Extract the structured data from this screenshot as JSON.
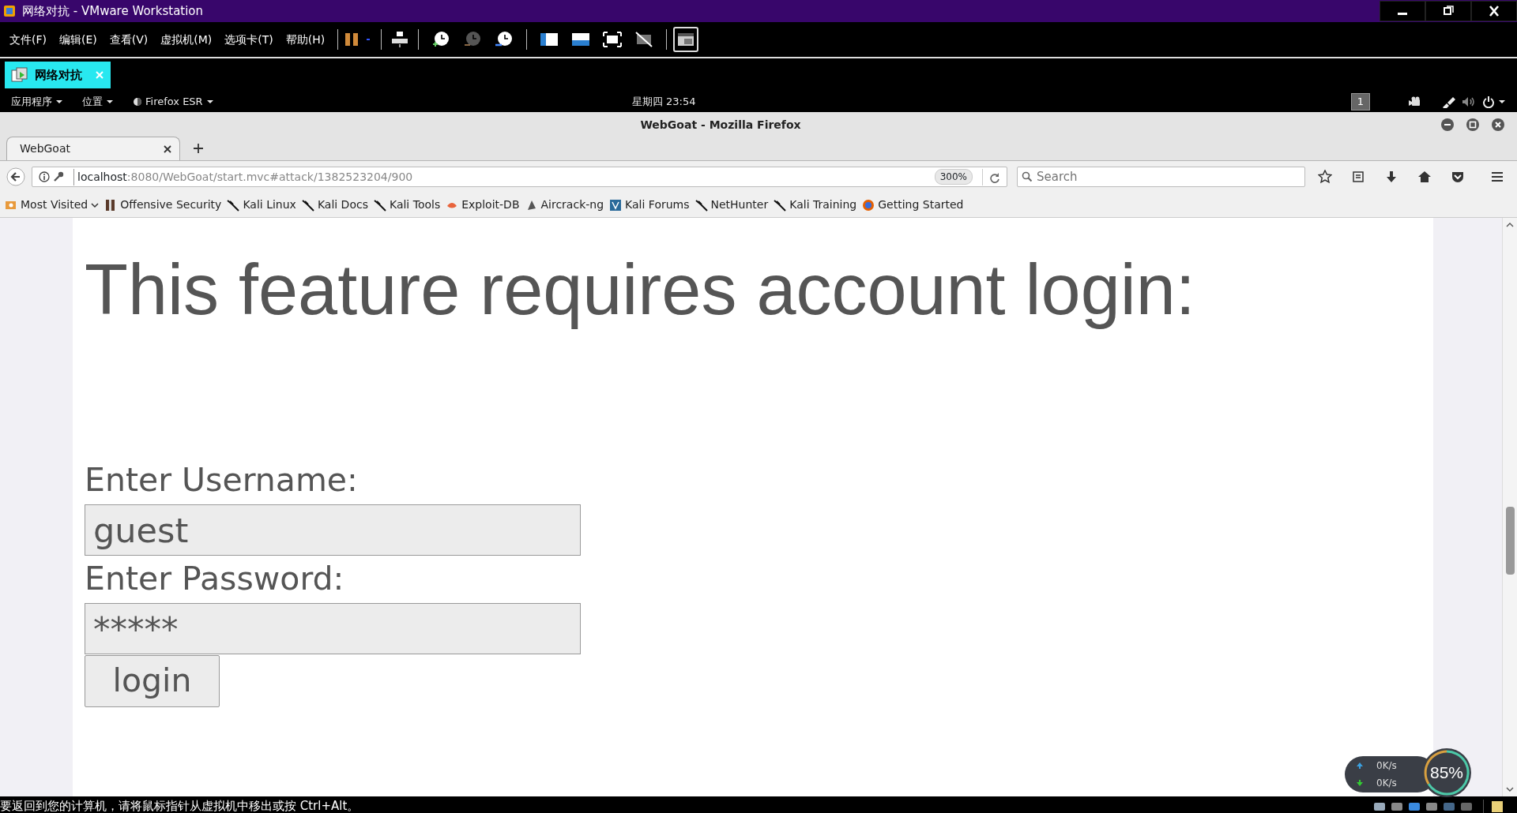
{
  "vmware": {
    "title": "网络对抗 - VMware Workstation",
    "menu": [
      "文件(F)",
      "编辑(E)",
      "查看(V)",
      "虚拟机(M)",
      "选项卡(T)",
      "帮助(H)"
    ]
  },
  "vm_tabs": [
    {
      "label": "网络对抗",
      "selected": true
    }
  ],
  "gnome_bar": {
    "applications": "应用程序",
    "places": "位置",
    "app": "Firefox ESR",
    "clock": "星期四 23:54",
    "workspace": "1"
  },
  "firefox": {
    "title": "WebGoat - Mozilla Firefox",
    "tabs": [
      {
        "label": "WebGoat",
        "selected": true
      }
    ],
    "url_host": "localhost",
    "url_path": ":8080/WebGoat/start.mvc#attack/1382523204/900",
    "zoom": "300%",
    "search_placeholder": "Search",
    "bookmarks": [
      "Most Visited",
      "Offensive Security",
      "Kali Linux",
      "Kali Docs",
      "Kali Tools",
      "Exploit-DB",
      "Aircrack-ng",
      "Kali Forums",
      "NetHunter",
      "Kali Training",
      "Getting Started"
    ]
  },
  "page": {
    "heading": "This feature requires account login:",
    "username_label": "Enter Username:",
    "username_value": "guest",
    "password_label": "Enter Password:",
    "password_value": "*****",
    "login_button": "login"
  },
  "net_widget": {
    "upload": "0K/s",
    "download": "0K/s",
    "percent": "85%"
  },
  "status_bar": "要返回到您的计算机，请将鼠标指针从虚拟机中移出或按 Ctrl+Alt。"
}
